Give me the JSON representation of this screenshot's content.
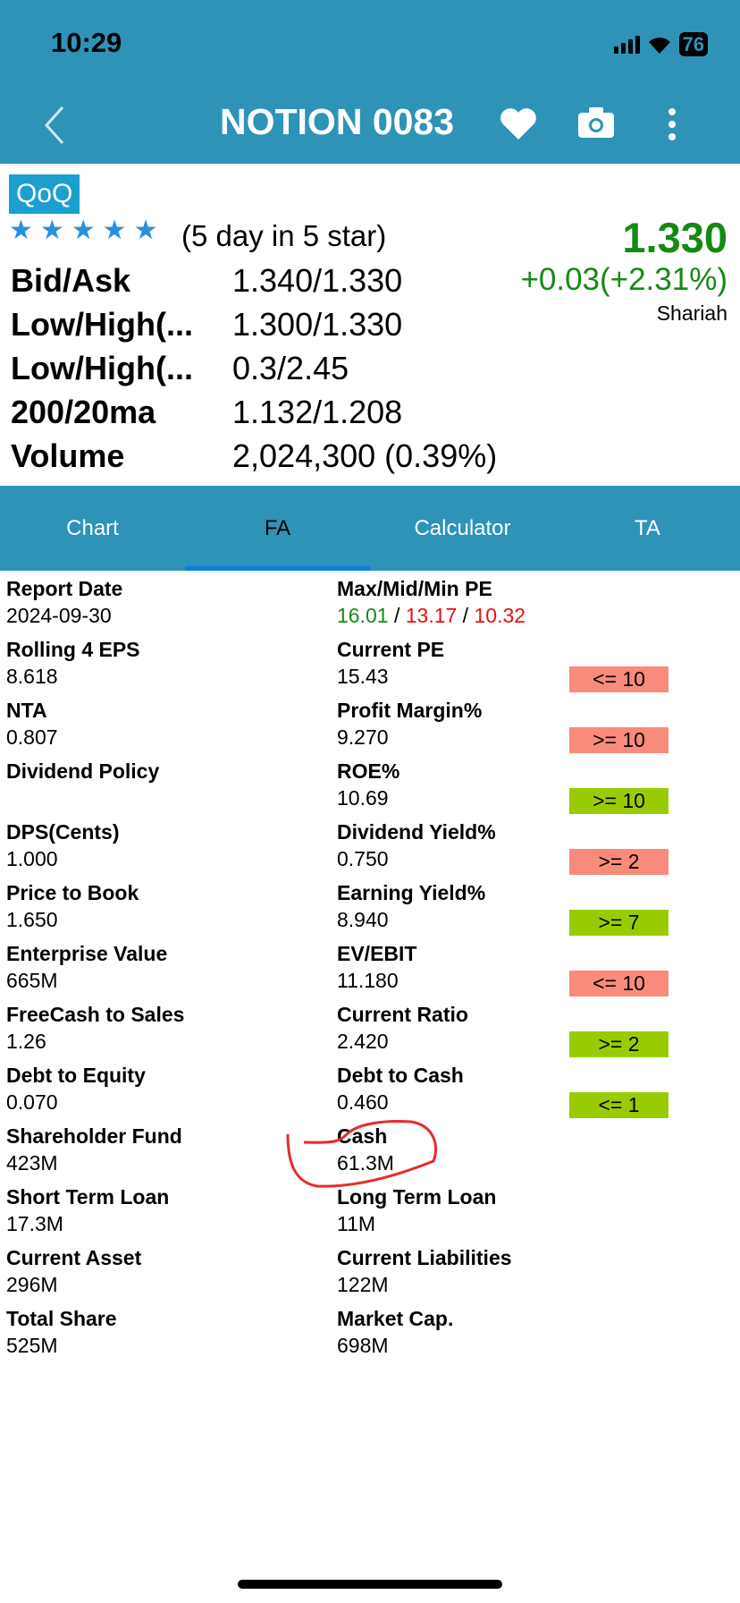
{
  "status_bar": {
    "time": "10:29",
    "battery": "76"
  },
  "header": {
    "title": "NOTION 0083"
  },
  "quote": {
    "badge": "QoQ",
    "stars": "★★★★★",
    "stars_text": "(5 day in 5 star)",
    "price": "1.330",
    "change": "+0.03(+2.31%)",
    "shariah": "Shariah",
    "rows": [
      {
        "label": "Bid/Ask",
        "value": "1.340/1.330"
      },
      {
        "label": "Low/High(...",
        "value": "1.300/1.330"
      },
      {
        "label": "Low/High(...",
        "value": "0.3/2.45"
      },
      {
        "label": "200/20ma",
        "value": "1.132/1.208"
      },
      {
        "label": "Volume",
        "value": "2,024,300 (0.39%)"
      }
    ]
  },
  "tabs": [
    {
      "label": "Chart"
    },
    {
      "label": "FA",
      "active": true
    },
    {
      "label": "Calculator"
    },
    {
      "label": "TA"
    }
  ],
  "fa": {
    "left": [
      {
        "label": "Report Date",
        "value": "2024-09-30"
      },
      {
        "label": "Rolling 4 EPS",
        "value": "8.618"
      },
      {
        "label": "NTA",
        "value": "0.807"
      },
      {
        "label": "Dividend Policy",
        "value": ""
      },
      {
        "label": "DPS(Cents)",
        "value": "1.000"
      },
      {
        "label": "Price to Book",
        "value": "1.650"
      },
      {
        "label": "Enterprise Value",
        "value": "665M"
      },
      {
        "label": "FreeCash to Sales",
        "value": "1.26"
      },
      {
        "label": "Debt to Equity",
        "value": "0.070"
      },
      {
        "label": "Shareholder Fund",
        "value": "423M"
      },
      {
        "label": "Short Term Loan",
        "value": "17.3M"
      },
      {
        "label": "Current Asset",
        "value": "296M"
      },
      {
        "label": "Total Share",
        "value": "525M"
      }
    ],
    "pe_range": {
      "label": "Max/Mid/Min PE",
      "max": "16.01",
      "mid": "13.17",
      "min": "10.32",
      "sep": " / "
    },
    "right": [
      {
        "label": "Current PE",
        "value": "15.43",
        "badge": "<= 10",
        "badge_color": "red"
      },
      {
        "label": "Profit Margin%",
        "value": "9.270",
        "badge": ">= 10",
        "badge_color": "red"
      },
      {
        "label": "ROE%",
        "value": "10.69",
        "badge": ">= 10",
        "badge_color": "green"
      },
      {
        "label": "Dividend Yield%",
        "value": "0.750",
        "badge": ">= 2",
        "badge_color": "red"
      },
      {
        "label": "Earning Yield%",
        "value": "8.940",
        "badge": ">= 7",
        "badge_color": "green"
      },
      {
        "label": "EV/EBIT",
        "value": "11.180",
        "badge": "<= 10",
        "badge_color": "red"
      },
      {
        "label": "Current Ratio",
        "value": "2.420",
        "badge": ">= 2",
        "badge_color": "green"
      },
      {
        "label": "Debt to Cash",
        "value": "0.460",
        "badge": "<= 1",
        "badge_color": "green"
      },
      {
        "label": "Cash",
        "value": "61.3M"
      },
      {
        "label": "Long Term Loan",
        "value": "11M"
      },
      {
        "label": "Current Liabilities",
        "value": "122M"
      },
      {
        "label": "Market Cap.",
        "value": "698M"
      }
    ]
  },
  "colors": {
    "header": "#2e93b6",
    "up": "#148a14",
    "red_badge": "#f98b7d",
    "green_badge": "#99cc00"
  }
}
